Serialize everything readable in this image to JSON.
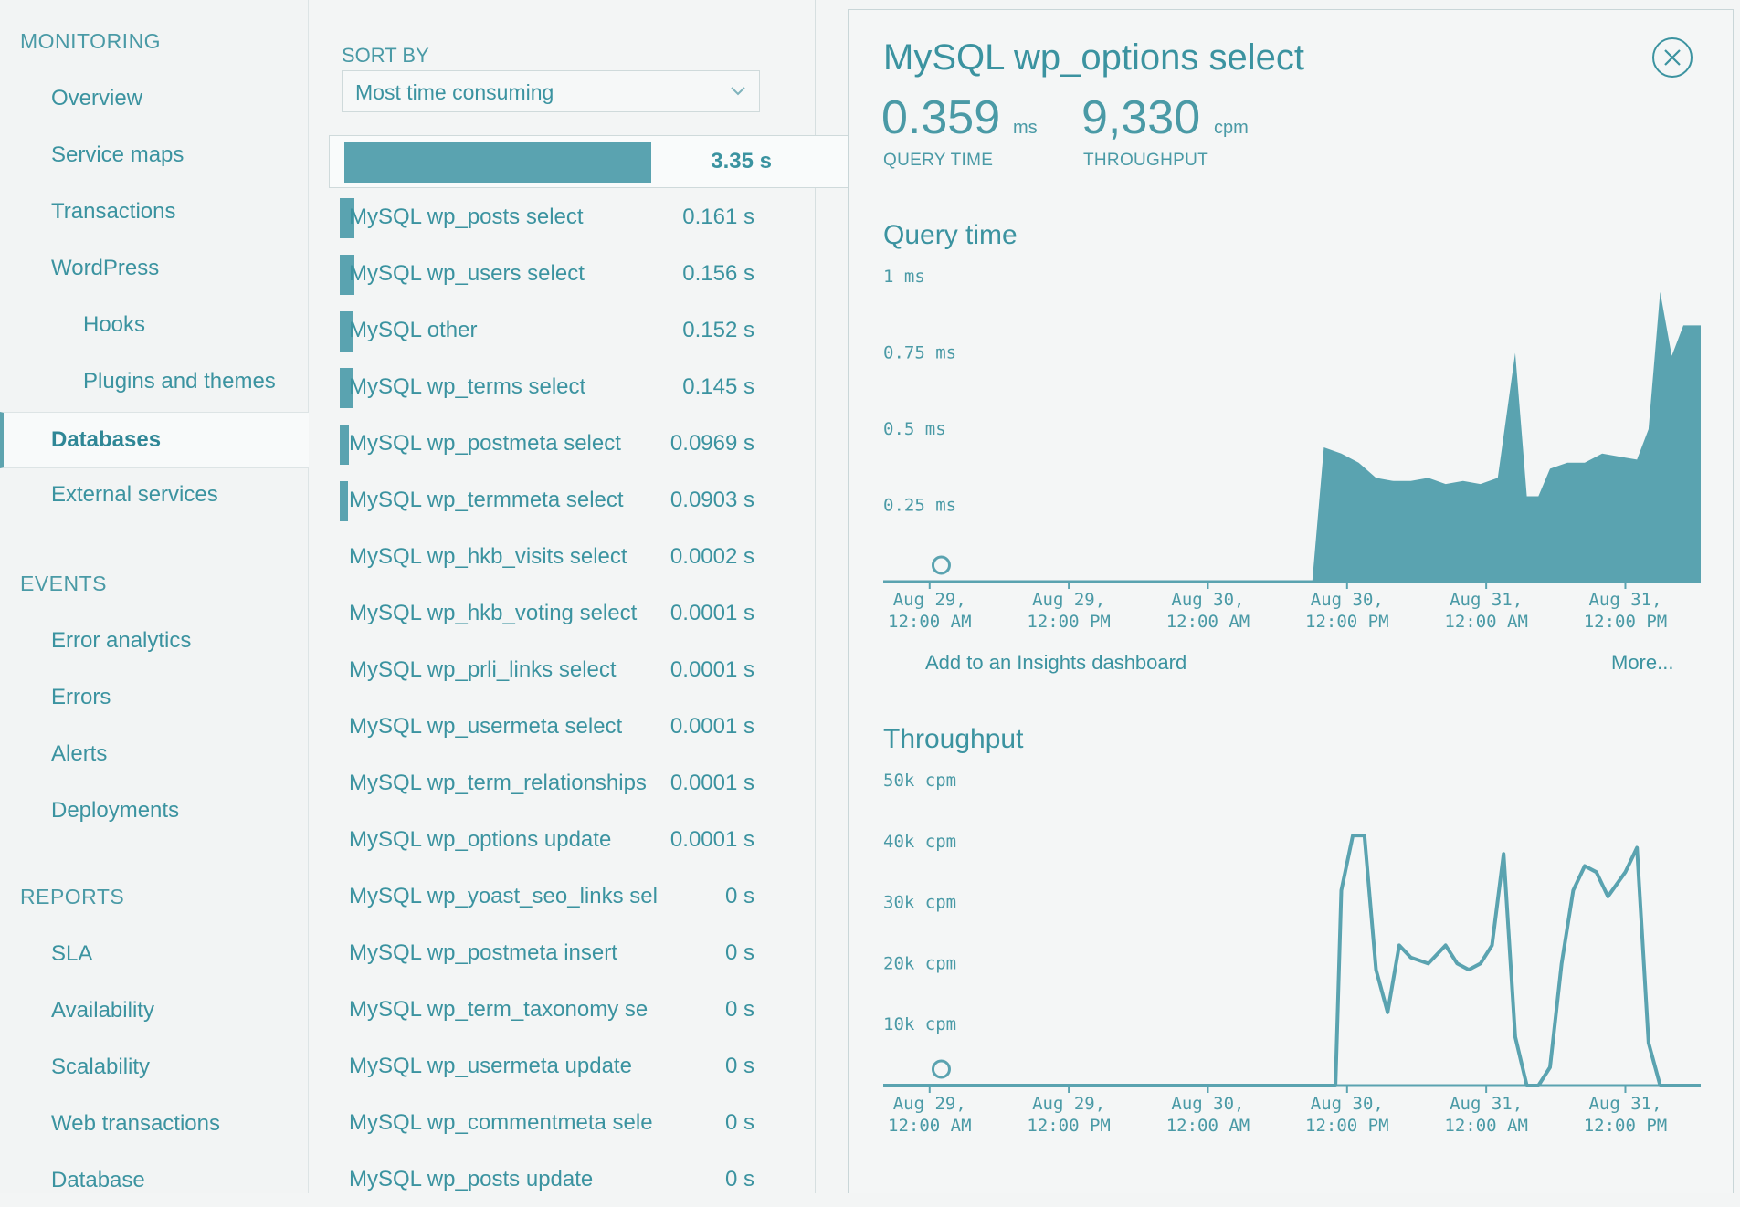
{
  "sidebar": {
    "sections": [
      {
        "header": "MONITORING"
      },
      {
        "header": "EVENTS"
      },
      {
        "header": "REPORTS"
      }
    ],
    "monitoring": [
      "Overview",
      "Service maps",
      "Transactions",
      "WordPress",
      "Hooks",
      "Plugins and themes",
      "Databases",
      "External services"
    ],
    "events": [
      "Error analytics",
      "Errors",
      "Alerts",
      "Deployments"
    ],
    "reports": [
      "SLA",
      "Availability",
      "Scalability",
      "Web transactions",
      "Database"
    ]
  },
  "list": {
    "sort_label": "SORT BY",
    "sort_value": "Most time consuming",
    "selected": {
      "name": "",
      "time": "3.35 s",
      "bar_fraction": 1.0
    },
    "rows": [
      {
        "name": "MySQL wp_posts select",
        "time": "0.161 s",
        "bar_fraction": 0.048
      },
      {
        "name": "MySQL wp_users select",
        "time": "0.156 s",
        "bar_fraction": 0.047
      },
      {
        "name": "MySQL other",
        "time": "0.152 s",
        "bar_fraction": 0.045
      },
      {
        "name": "MySQL wp_terms select",
        "time": "0.145 s",
        "bar_fraction": 0.043
      },
      {
        "name": "MySQL wp_postmeta select",
        "time": "0.0969 s",
        "bar_fraction": 0.029
      },
      {
        "name": "MySQL wp_termmeta select",
        "time": "0.0903 s",
        "bar_fraction": 0.027
      },
      {
        "name": "MySQL wp_hkb_visits select",
        "time": "0.0002 s",
        "bar_fraction": 0
      },
      {
        "name": "MySQL wp_hkb_voting select",
        "time": "0.0001 s",
        "bar_fraction": 0
      },
      {
        "name": "MySQL wp_prli_links select",
        "time": "0.0001 s",
        "bar_fraction": 0
      },
      {
        "name": "MySQL wp_usermeta select",
        "time": "0.0001 s",
        "bar_fraction": 0
      },
      {
        "name": "MySQL wp_term_relationships",
        "time": "0.0001 s",
        "bar_fraction": 0
      },
      {
        "name": "MySQL wp_options update",
        "time": "0.0001 s",
        "bar_fraction": 0
      },
      {
        "name": "MySQL wp_yoast_seo_links sel",
        "time": "0 s",
        "bar_fraction": 0
      },
      {
        "name": "MySQL wp_postmeta insert",
        "time": "0 s",
        "bar_fraction": 0
      },
      {
        "name": "MySQL wp_term_taxonomy se",
        "time": "0 s",
        "bar_fraction": 0
      },
      {
        "name": "MySQL wp_usermeta update",
        "time": "0 s",
        "bar_fraction": 0
      },
      {
        "name": "MySQL wp_commentmeta sele",
        "time": "0 s",
        "bar_fraction": 0
      },
      {
        "name": "MySQL wp_posts update",
        "time": "0 s",
        "bar_fraction": 0
      }
    ]
  },
  "detail": {
    "title": "MySQL wp_options select",
    "query_time_value": "0.359",
    "query_time_unit": "ms",
    "query_time_label": "QUERY TIME",
    "throughput_value": "9,330",
    "throughput_unit": "cpm",
    "throughput_label": "THROUGHPUT",
    "insights_link": "Add to an Insights dashboard",
    "more_link": "More..."
  },
  "colors": {
    "accent": "#3b93a0",
    "fill": "#5aa3b0",
    "background": "#f3f5f5"
  },
  "chart_data": [
    {
      "type": "area",
      "title": "Query time",
      "yticks": [
        "1 ms",
        "0.75 ms",
        "0.5 ms",
        "0.25 ms"
      ],
      "ytick_values": [
        1,
        0.75,
        0.5,
        0.25
      ],
      "ylim": [
        0,
        1
      ],
      "xticks": [
        [
          "Aug 29,",
          "12:00 AM"
        ],
        [
          "Aug 29,",
          "12:00 PM"
        ],
        [
          "Aug 30,",
          "12:00 AM"
        ],
        [
          "Aug 30,",
          "12:00 PM"
        ],
        [
          "Aug 31,",
          "12:00 AM"
        ],
        [
          "Aug 31,",
          "12:00 PM"
        ]
      ],
      "xtick_hours": [
        0,
        12,
        24,
        36,
        48,
        60
      ],
      "x_hours": [
        -4,
        33,
        34,
        35.5,
        37,
        38.5,
        40,
        41.5,
        43,
        44.5,
        46,
        47.5,
        49,
        50.5,
        51.5,
        52.5,
        53.5,
        55,
        56.5,
        58,
        59.5,
        61,
        62,
        63,
        64,
        65,
        66.5
      ],
      "values": [
        0,
        0,
        0.44,
        0.42,
        0.39,
        0.34,
        0.33,
        0.33,
        0.34,
        0.32,
        0.33,
        0.32,
        0.34,
        0.75,
        0.28,
        0.28,
        0.37,
        0.39,
        0.39,
        0.42,
        0.41,
        0.4,
        0.5,
        0.95,
        0.74,
        0.84,
        0.84
      ]
    },
    {
      "type": "line",
      "title": "Throughput",
      "yticks": [
        "50k cpm",
        "40k cpm",
        "30k cpm",
        "20k cpm",
        "10k cpm"
      ],
      "ytick_values": [
        50000,
        40000,
        30000,
        20000,
        10000
      ],
      "ylim": [
        0,
        50000
      ],
      "xticks": [
        [
          "Aug 29,",
          "12:00 AM"
        ],
        [
          "Aug 29,",
          "12:00 PM"
        ],
        [
          "Aug 30,",
          "12:00 AM"
        ],
        [
          "Aug 30,",
          "12:00 PM"
        ],
        [
          "Aug 31,",
          "12:00 AM"
        ],
        [
          "Aug 31,",
          "12:00 PM"
        ]
      ],
      "xtick_hours": [
        0,
        12,
        24,
        36,
        48,
        60
      ],
      "x_hours": [
        -4,
        35,
        35.5,
        36.5,
        37.5,
        38.5,
        39.5,
        40.5,
        41.5,
        43,
        44.5,
        45.5,
        46.5,
        47.5,
        48.5,
        49.5,
        50.5,
        51.5,
        52.5,
        53.5,
        54.5,
        55.5,
        56.5,
        57.5,
        58.5,
        60,
        61,
        62,
        63,
        64,
        66.5
      ],
      "values": [
        0,
        0,
        32000,
        41000,
        41000,
        19000,
        12000,
        23000,
        21000,
        20000,
        23000,
        20000,
        19000,
        20000,
        23000,
        38000,
        8000,
        0,
        0,
        3000,
        20000,
        32000,
        36000,
        35000,
        31000,
        35000,
        39000,
        7000,
        0,
        0,
        0
      ]
    }
  ]
}
